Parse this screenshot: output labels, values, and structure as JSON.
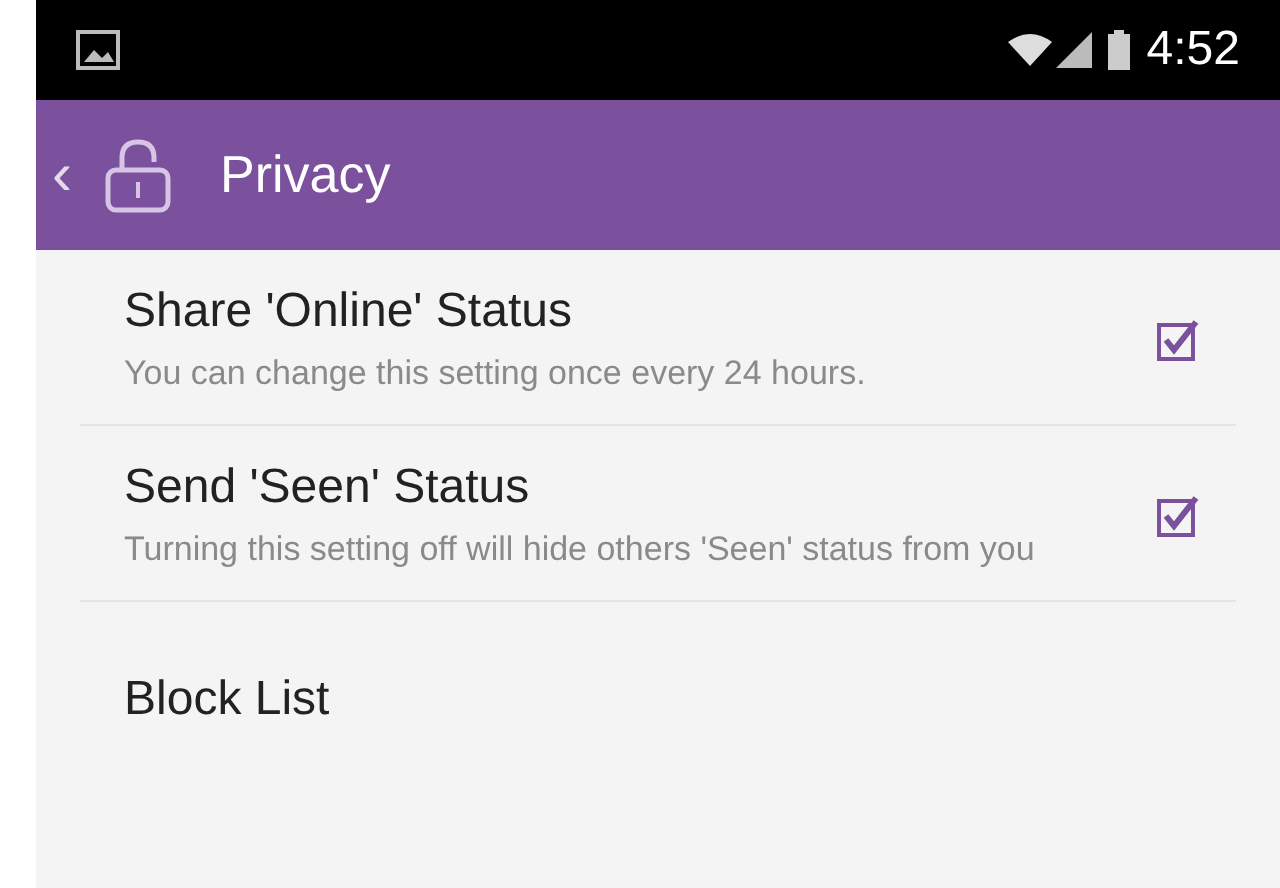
{
  "status_bar": {
    "time": "4:52"
  },
  "app_bar": {
    "back": "‹",
    "title": "Privacy"
  },
  "settings": [
    {
      "kind": "checkbox",
      "title": "Share 'Online' Status",
      "summary": "You can change this setting once every 24 hours.",
      "checked": true
    },
    {
      "kind": "checkbox",
      "title": "Send 'Seen' Status",
      "summary": "Turning this setting off will hide others 'Seen' status from you",
      "checked": true
    },
    {
      "kind": "link",
      "title": "Block List"
    }
  ]
}
